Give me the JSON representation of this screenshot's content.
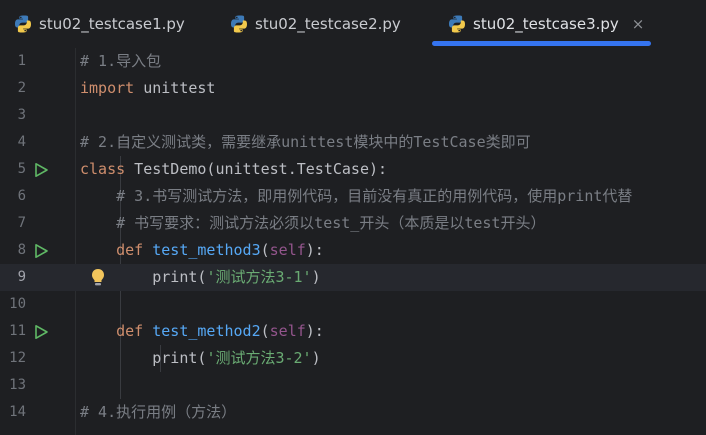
{
  "tabs": [
    {
      "label": "stu02_testcase1.py",
      "active": false
    },
    {
      "label": "stu02_testcase2.py",
      "active": false
    },
    {
      "label": "stu02_testcase3.py",
      "active": true
    }
  ],
  "tab_close_glyph": "×",
  "icons": {
    "tab": "python-file-icon",
    "run": "run-gutter-icon",
    "intention": "lightbulb-icon"
  },
  "colors": {
    "background": "#1e1f22",
    "keyword": "#cf8e6d",
    "function": "#56a8f5",
    "self": "#94558d",
    "string": "#6aab73",
    "comment": "#7a7e85",
    "text": "#bcbec4",
    "accent": "#3574f0",
    "run_icon": "#5fb865",
    "bulb": "#f2c55c"
  },
  "editor": {
    "current_line": 9,
    "lines": [
      {
        "num": "1",
        "tokens": [
          {
            "t": "# 1.导入包",
            "c": "cmt"
          }
        ]
      },
      {
        "num": "2",
        "tokens": [
          {
            "t": "import",
            "c": "kw"
          },
          {
            "t": " unittest",
            "c": ""
          }
        ]
      },
      {
        "num": "3",
        "tokens": []
      },
      {
        "num": "4",
        "tokens": [
          {
            "t": "# 2.自定义测试类，需要继承unittest模块中的TestCase类即可",
            "c": "cmt"
          }
        ]
      },
      {
        "num": "5",
        "run": true,
        "tokens": [
          {
            "t": "class",
            "c": "kw"
          },
          {
            "t": " TestDemo(unittest.TestCase):",
            "c": ""
          }
        ]
      },
      {
        "num": "6",
        "tokens": [
          {
            "t": "    # 3.书写测试方法，即用例代码，目前没有真正的用例代码，使用print代替",
            "c": "cmt"
          }
        ]
      },
      {
        "num": "7",
        "tokens": [
          {
            "t": "    # 书写要求：测试方法必须以test_开头（本质是以test开头）",
            "c": "cmt"
          }
        ]
      },
      {
        "num": "8",
        "run": true,
        "tokens": [
          {
            "t": "    ",
            "c": ""
          },
          {
            "t": "def",
            "c": "kw"
          },
          {
            "t": " ",
            "c": ""
          },
          {
            "t": "test_method3",
            "c": "fn"
          },
          {
            "t": "(",
            "c": ""
          },
          {
            "t": "self",
            "c": "sf"
          },
          {
            "t": "):",
            "c": ""
          }
        ]
      },
      {
        "num": "9",
        "bulb": true,
        "tokens": [
          {
            "t": "        print(",
            "c": ""
          },
          {
            "t": "'测试方法3-1'",
            "c": "str"
          },
          {
            "t": ")",
            "c": ""
          }
        ]
      },
      {
        "num": "10",
        "tokens": []
      },
      {
        "num": "11",
        "run": true,
        "tokens": [
          {
            "t": "    ",
            "c": ""
          },
          {
            "t": "def",
            "c": "kw"
          },
          {
            "t": " ",
            "c": ""
          },
          {
            "t": "test_method2",
            "c": "fn"
          },
          {
            "t": "(",
            "c": ""
          },
          {
            "t": "self",
            "c": "sf"
          },
          {
            "t": "):",
            "c": ""
          }
        ]
      },
      {
        "num": "12",
        "tokens": [
          {
            "t": "        print(",
            "c": ""
          },
          {
            "t": "'测试方法3-2'",
            "c": "str"
          },
          {
            "t": ")",
            "c": ""
          }
        ]
      },
      {
        "num": "13",
        "tokens": []
      },
      {
        "num": "14",
        "tokens": [
          {
            "t": "# 4.执行用例（方法）",
            "c": "cmt"
          }
        ]
      }
    ]
  }
}
